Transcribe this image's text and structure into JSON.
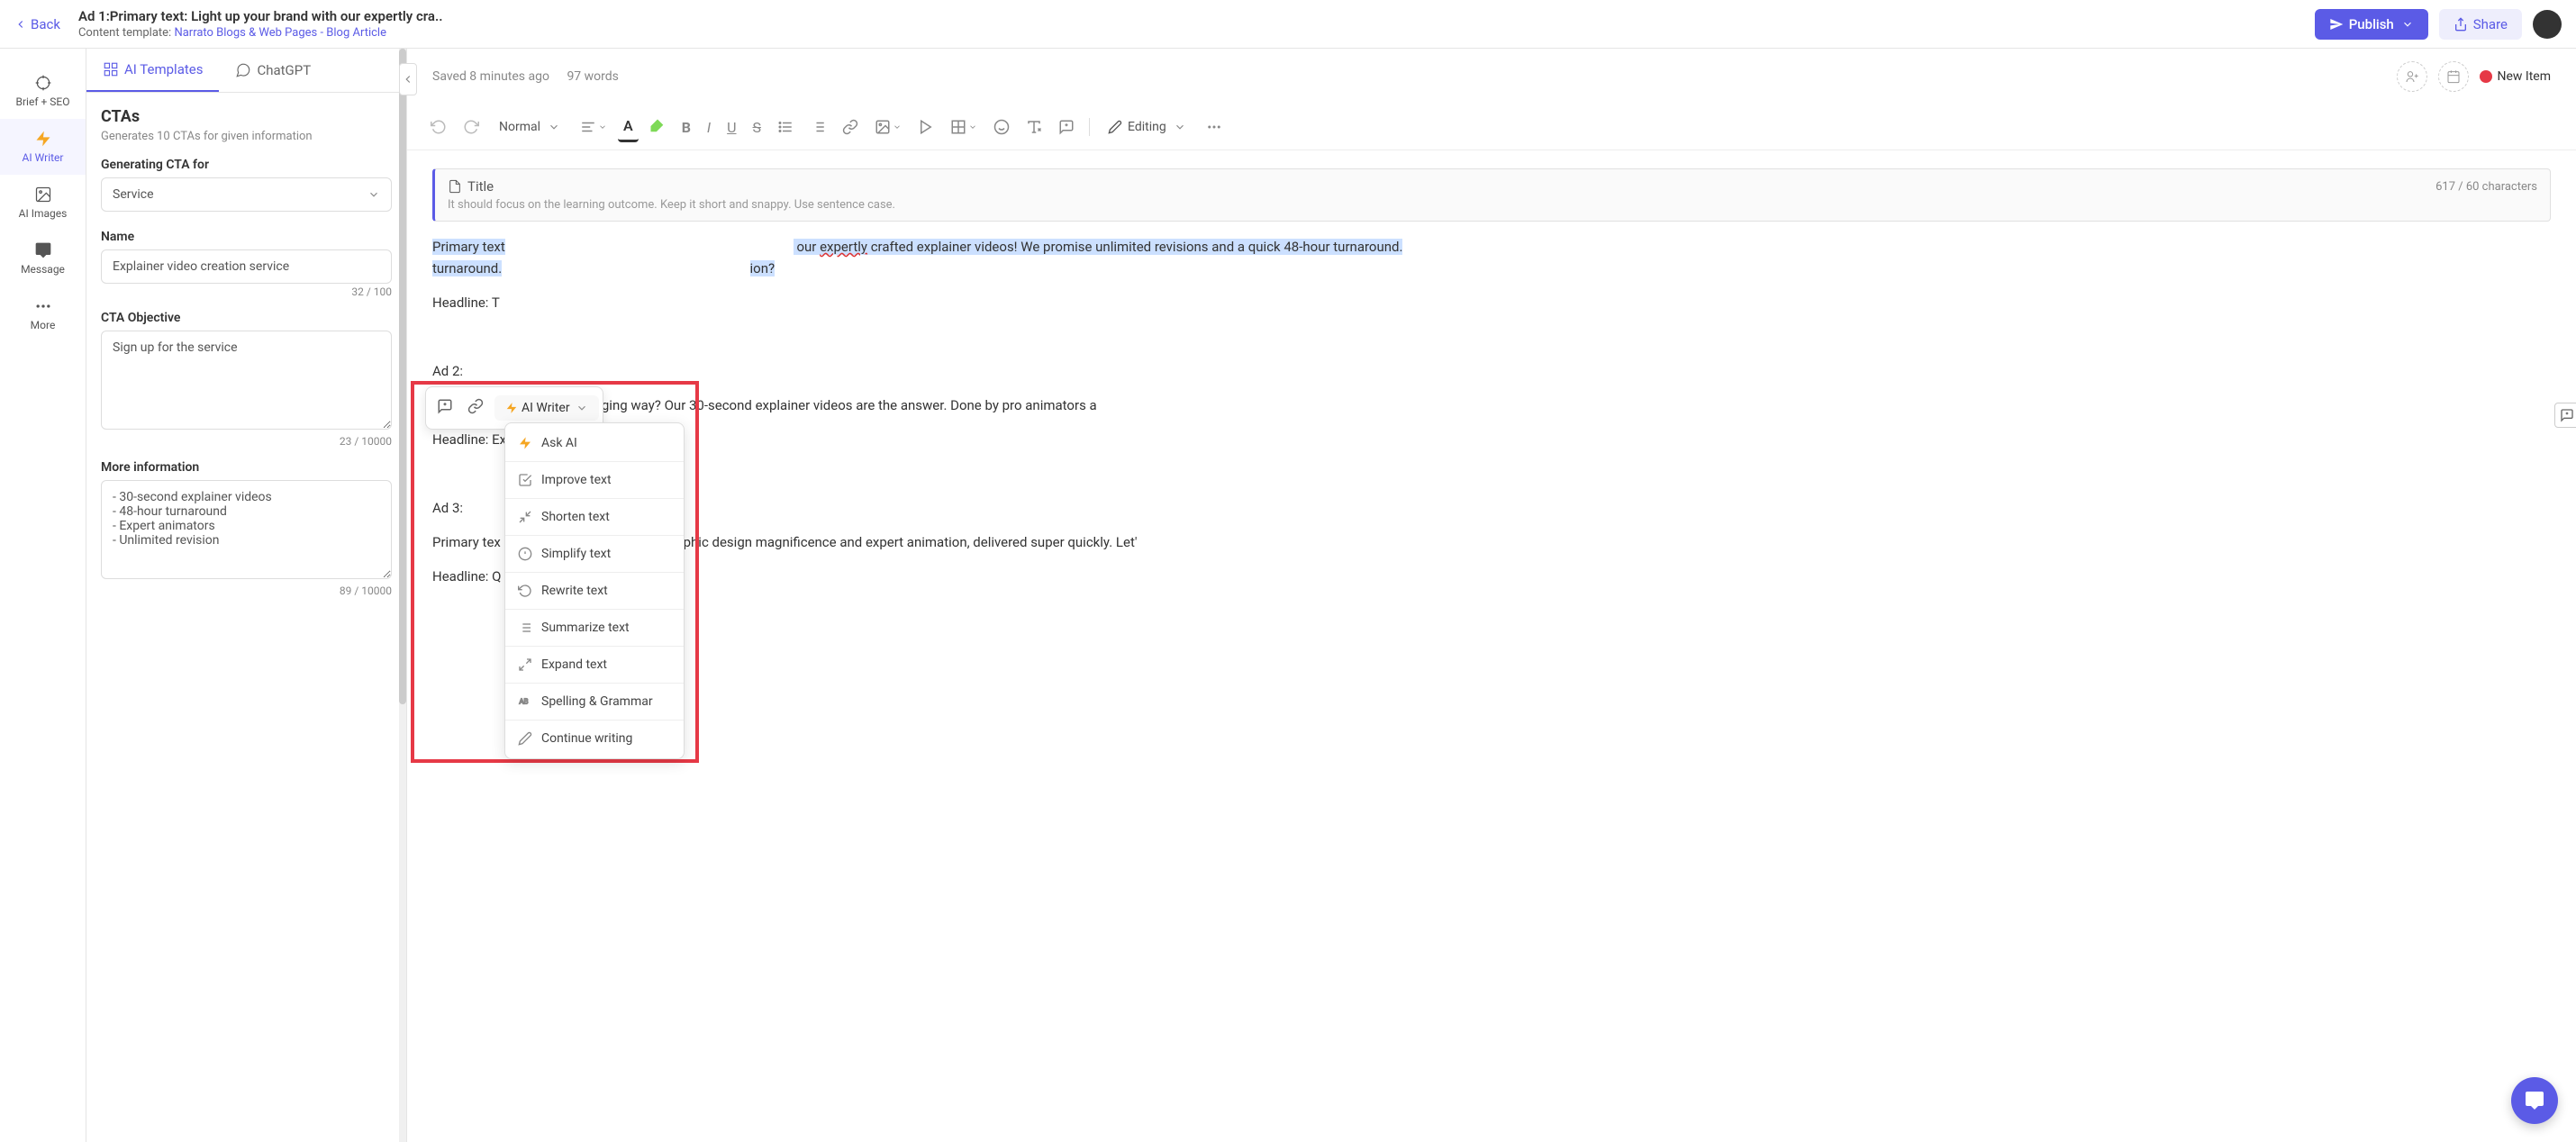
{
  "header": {
    "back": "Back",
    "title": "Ad 1:Primary text: Light up your brand with our expertly cra..",
    "template_label": "Content template:",
    "template_link": "Narrato Blogs & Web Pages - Blog Article",
    "publish": "Publish",
    "share": "Share"
  },
  "rail": {
    "brief": "Brief + SEO",
    "writer": "AI Writer",
    "images": "AI Images",
    "message": "Message",
    "more": "More"
  },
  "tabs": {
    "templates": "AI Templates",
    "chatgpt": "ChatGPT"
  },
  "cta": {
    "title": "CTAs",
    "desc": "Generates 10 CTAs for given information",
    "gen_label": "Generating CTA for",
    "gen_value": "Service",
    "name_label": "Name",
    "name_value": "Explainer video creation service",
    "name_counter": "32 / 100",
    "obj_label": "CTA Objective",
    "obj_value": "Sign up for the service",
    "obj_counter": "23 / 10000",
    "more_label": "More information",
    "more_value": "- 30-second explainer videos\n- 48-hour turnaround\n- Expert animators\n- Unlimited revision",
    "more_counter": "89 / 10000"
  },
  "editor": {
    "saved": "Saved 8 minutes ago",
    "words": "97 words",
    "status": "New Item",
    "title_label": "Title",
    "title_count": "617 / 60 characters",
    "title_hint": "It should focus on the learning outcome. Keep it short and snappy. Use sentence case.",
    "style_select": "Normal",
    "editing": "Editing",
    "ai_writer_btn": "AI Writer"
  },
  "ai_menu": {
    "ask": "Ask AI",
    "improve": "Improve text",
    "shorten": "Shorten text",
    "simplify": "Simplify text",
    "rewrite": "Rewrite text",
    "summarize": "Summarize text",
    "expand": "Expand text",
    "spelling": "Spelling & Grammar",
    "continue": "Continue writing"
  },
  "content": {
    "p1_a": "Primary text",
    "p1_b": " our ",
    "p1_c": "expertly",
    "p1_d": " crafted explainer videos! We promise unlimited revisions and a quick 48-hour turnaround.",
    "p1_e": "ion?",
    "h1": "Headline: T",
    "ad2": "Ad 2:",
    "p2": "Primary tex                                                   ideas in an engaging way? Our 30-second explainer videos are the answer. Done by pro animators a",
    "h2": "Headline: Ex",
    "ad3": "Ad 3:",
    "p3": "Primary tex                                                  u  30-sec explainer videos. Graphic design magnificence and expert animation, delivered super quickly. Let'",
    "h3": "Headline: Q                                                 y"
  }
}
